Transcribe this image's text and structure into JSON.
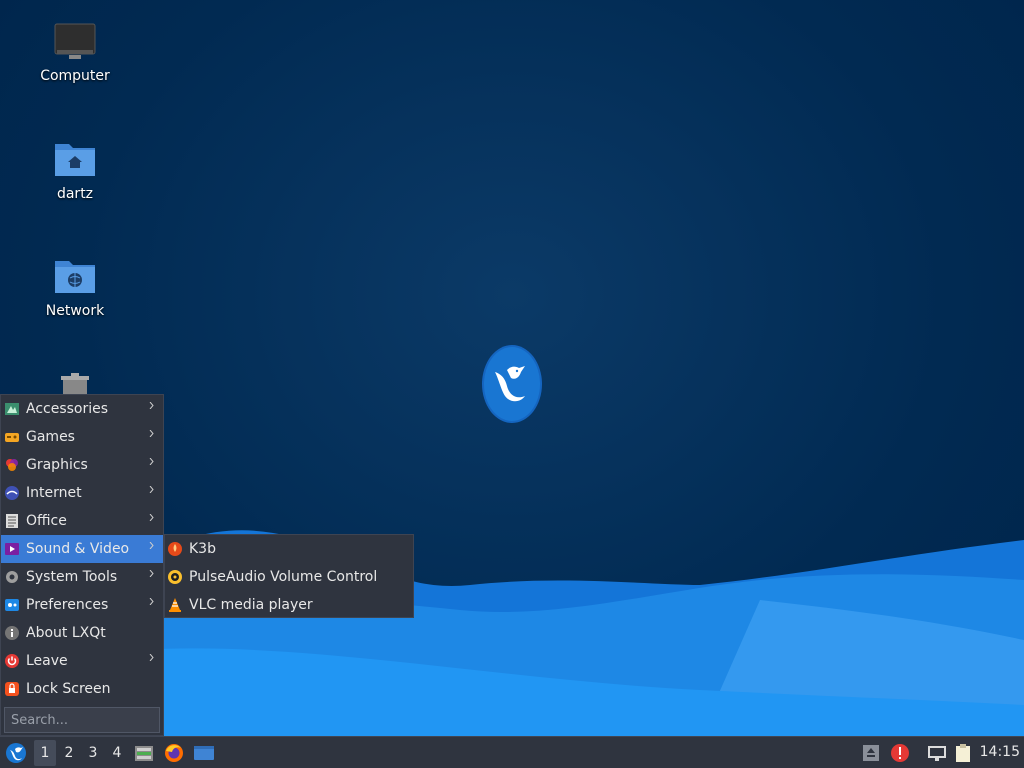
{
  "desktop": {
    "icons": [
      {
        "label": "Computer",
        "icon": "computer-icon"
      },
      {
        "label": "dartz",
        "icon": "home-folder-icon"
      },
      {
        "label": "Network",
        "icon": "network-folder-icon"
      },
      {
        "label": "",
        "icon": "trash-icon"
      }
    ],
    "logo": "lubuntu-bird-logo"
  },
  "menu": {
    "items": [
      {
        "label": "Accessories",
        "icon": "accessories-icon",
        "has_submenu": true
      },
      {
        "label": "Games",
        "icon": "games-icon",
        "has_submenu": true
      },
      {
        "label": "Graphics",
        "icon": "graphics-icon",
        "has_submenu": true
      },
      {
        "label": "Internet",
        "icon": "internet-icon",
        "has_submenu": true
      },
      {
        "label": "Office",
        "icon": "office-icon",
        "has_submenu": true
      },
      {
        "label": "Sound & Video",
        "icon": "sound-video-icon",
        "has_submenu": true,
        "active": true
      },
      {
        "label": "System Tools",
        "icon": "system-tools-icon",
        "has_submenu": true
      },
      {
        "label": "Preferences",
        "icon": "preferences-icon",
        "has_submenu": true
      },
      {
        "label": "About LXQt",
        "icon": "info-icon",
        "has_submenu": false
      },
      {
        "label": "Leave",
        "icon": "power-icon",
        "has_submenu": true
      },
      {
        "label": "Lock Screen",
        "icon": "lock-icon",
        "has_submenu": false
      }
    ],
    "search_placeholder": "Search..."
  },
  "submenu": {
    "items": [
      {
        "label": "K3b",
        "icon": "k3b-icon"
      },
      {
        "label": "PulseAudio Volume Control",
        "icon": "pulseaudio-icon"
      },
      {
        "label": "VLC media player",
        "icon": "vlc-icon"
      }
    ]
  },
  "taskbar": {
    "workspaces": [
      "1",
      "2",
      "3",
      "4"
    ],
    "active_workspace": "1",
    "launchers": [
      "file-manager-icon",
      "firefox-icon",
      "desktop-show-icon"
    ],
    "tray": [
      "eject-icon",
      "update-alert-icon",
      "network-icon",
      "clipboard-icon"
    ],
    "clock": "14:15"
  },
  "colors": {
    "accent": "#3a7bd5",
    "panel": "#2f343f",
    "desktop_bg": "#012a52",
    "wave": "#1e88e5"
  }
}
